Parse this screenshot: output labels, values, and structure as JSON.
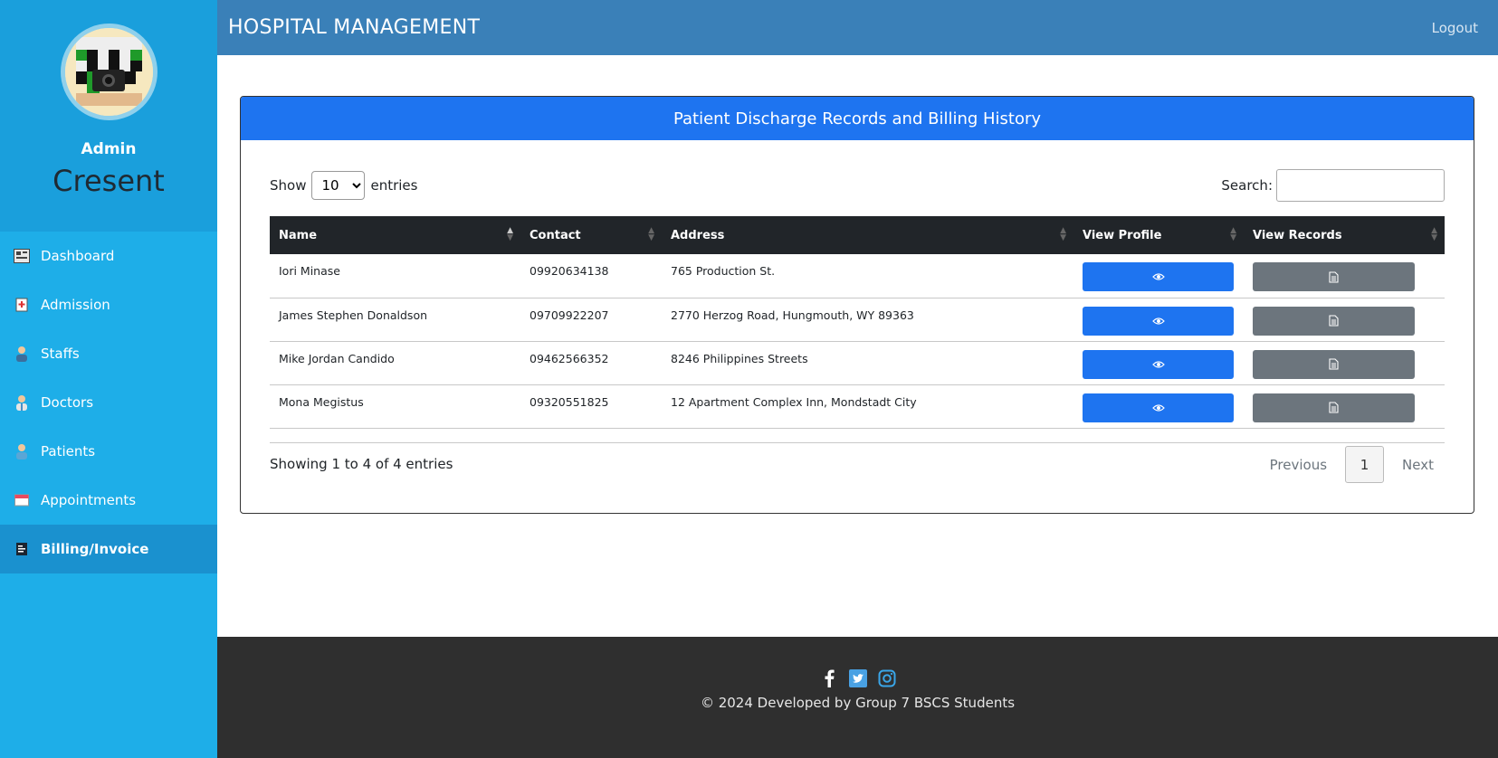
{
  "app": {
    "title": "HOSPITAL MANAGEMENT",
    "logout_label": "Logout"
  },
  "profile": {
    "role": "Admin",
    "username": "Cresent"
  },
  "sidebar": {
    "items": [
      {
        "label": "Dashboard",
        "icon": "dashboard-icon"
      },
      {
        "label": "Admission",
        "icon": "admission-icon"
      },
      {
        "label": "Staffs",
        "icon": "staff-icon"
      },
      {
        "label": "Doctors",
        "icon": "doctor-icon"
      },
      {
        "label": "Patients",
        "icon": "patient-icon"
      },
      {
        "label": "Appointments",
        "icon": "calendar-icon"
      },
      {
        "label": "Billing/Invoice",
        "icon": "invoice-icon",
        "active": true
      }
    ]
  },
  "card": {
    "title": "Patient Discharge Records and Billing History"
  },
  "controls": {
    "show_label": "Show",
    "entries_label": "entries",
    "page_size": "10",
    "search_label": "Search:"
  },
  "table": {
    "headers": [
      "Name",
      "Contact",
      "Address",
      "View Profile",
      "View Records"
    ],
    "rows": [
      {
        "name": "Iori Minase",
        "contact": "09920634138",
        "address": "765 Production St."
      },
      {
        "name": "James Stephen Donaldson",
        "contact": "09709922207",
        "address": "2770 Herzog Road, Hungmouth, WY 89363"
      },
      {
        "name": "Mike Jordan Candido",
        "contact": "09462566352",
        "address": "8246 Philippines Streets"
      },
      {
        "name": "Mona Megistus",
        "contact": "09320551825",
        "address": "12 Apartment Complex Inn, Mondstadt City"
      }
    ]
  },
  "pagination": {
    "info": "Showing 1 to 4 of 4 entries",
    "previous": "Previous",
    "page": "1",
    "next": "Next"
  },
  "footer": {
    "copyright": "© 2024 Developed by Group 7 BSCS Students"
  },
  "colors": {
    "sidebar": "#1eaee8",
    "topbar": "#3a80b8",
    "primary": "#1e74f0",
    "secondary": "#6c757d",
    "footer": "#2f2f2f"
  }
}
